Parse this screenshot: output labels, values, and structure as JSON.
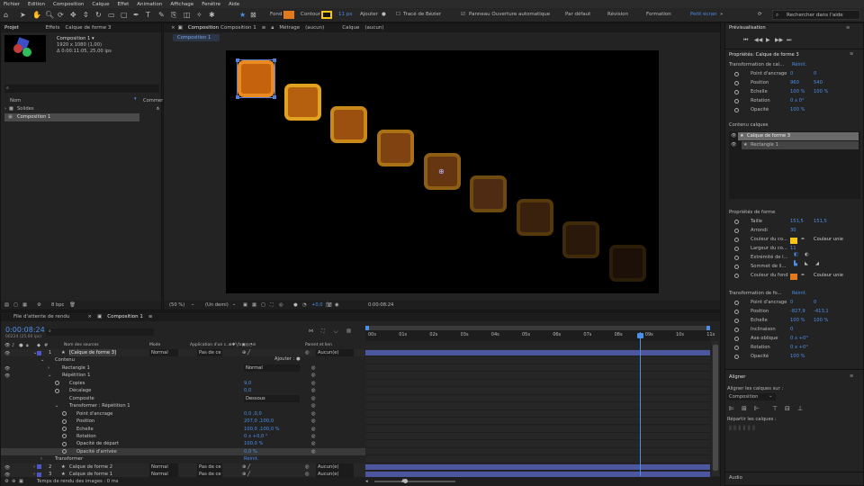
{
  "menu": [
    "Fichier",
    "Edition",
    "Composition",
    "Calque",
    "Effet",
    "Animation",
    "Affichage",
    "Fenêtre",
    "Aide"
  ],
  "toolbar": {
    "fond": "Fond",
    "contour": "Contour",
    "stroke_px": "11 px",
    "ajouter": "Ajouter",
    "bezier": "Tracé de Bézier",
    "panneau": "Panneau Ouverture automatique",
    "workspaces": [
      "Par défaut",
      "Révision",
      "Formation",
      "Petit écran"
    ],
    "search": "Rechercher dans l'aide",
    "fill_color": "#e07a1c",
    "stroke_color": "#f5c518"
  },
  "project": {
    "tab": "Projet",
    "effects_tab": "Effets",
    "effects_target": "Calque de forme 3",
    "info_name": "Composition 1 ▾",
    "info_size": "1920 x 1080 (1,00)",
    "info_dur": "Δ 0:00:11:05, 25,00 ips",
    "col_name": "Nom",
    "col_comment": "Commenta",
    "items": [
      "Solides",
      "Composition 1"
    ],
    "bpc": "8 bpc"
  },
  "viewer": {
    "tab": "Composition",
    "tab_comp": "Composition 1",
    "metrage": "Métrage",
    "metrage_val": "(aucun)",
    "calque": "Calque",
    "calque_val": "(aucun)",
    "breadcrumb": "Composition 1",
    "zoom": "(50 %)",
    "resolution": "(Un demi)",
    "exposure": "+0,0",
    "timecode": "0:00:08:24"
  },
  "preview": {
    "title": "Prévisualisation"
  },
  "properties": {
    "title": "Propriétés: Calque de forme 3",
    "transform_title": "Transformation de cal...",
    "reinit": "Réinit.",
    "transform": [
      {
        "label": "Point d'ancrage",
        "v1": "0",
        "v2": "0"
      },
      {
        "label": "Position",
        "v1": "960",
        "v2": "540"
      },
      {
        "label": "Echelle",
        "v1": "100 %",
        "v2": "100 %"
      },
      {
        "label": "Rotation",
        "v1": "0 x 0°",
        "v2": ""
      },
      {
        "label": "Opacité",
        "v1": "100 %",
        "v2": ""
      }
    ],
    "content_title": "Contenu calques",
    "content_items": [
      "Calque de forme 3",
      "Rectangle 1"
    ],
    "shape_title": "Propriétés de forme",
    "shape": [
      {
        "label": "Taille",
        "v1": "151,5",
        "v2": "151,5"
      },
      {
        "label": "Arrondi",
        "v1": "30",
        "v2": ""
      },
      {
        "label": "Couleur du co...",
        "v1": "Couleur unie",
        "v2": ""
      },
      {
        "label": "Largeur du co...",
        "v1": "11",
        "v2": ""
      },
      {
        "label": "Extrémité de l...",
        "v1": "",
        "v2": ""
      },
      {
        "label": "Sommet de li...",
        "v1": "",
        "v2": ""
      },
      {
        "label": "Couleur du fond",
        "v1": "Couleur unie",
        "v2": ""
      }
    ],
    "shape_transform_title": "Transformation de fo...",
    "shape_transform": [
      {
        "label": "Point d'ancrage",
        "v1": "0",
        "v2": "0"
      },
      {
        "label": "Position",
        "v1": "-827,9",
        "v2": "-413,1"
      },
      {
        "label": "Echelle",
        "v1": "100 %",
        "v2": "100 %"
      },
      {
        "label": "Inclinaison",
        "v1": "0",
        "v2": ""
      },
      {
        "label": "Axe oblique",
        "v1": "0 x +0°",
        "v2": ""
      },
      {
        "label": "Rotation",
        "v1": "0 x +0°",
        "v2": ""
      },
      {
        "label": "Opacité",
        "v1": "100 %",
        "v2": ""
      }
    ]
  },
  "align": {
    "title": "Aligner",
    "label": "Aligner les calques sur :",
    "target": "Composition",
    "distribute": "Répartir les calques :"
  },
  "audio": {
    "title": "Audio"
  },
  "timeline": {
    "tab_queue": "File d'attente de rendu",
    "tab_comp": "Composition 1",
    "timecode": "0:00:08:24",
    "frames": "00224 (25,00 ips)",
    "headers": {
      "name": "Nom des sources",
      "mode": "Mode",
      "app": "Application d'un c...",
      "parent": "Parent et lien"
    },
    "ajouter": "Ajouter :",
    "ruler": [
      "00s",
      "01s",
      "02s",
      "03s",
      "04s",
      "05s",
      "06s",
      "07s",
      "08s",
      "09s",
      "10s",
      "11s"
    ],
    "rows": [
      {
        "label": "[Calque de forme 3]",
        "indent": 0,
        "num": "1",
        "mode": "Normal",
        "match": "Pas de ce",
        "parent": "Aucun(e)",
        "value": ""
      },
      {
        "label": "Contenu",
        "indent": 1,
        "value": ""
      },
      {
        "label": "Rectangle 1",
        "indent": 2,
        "value": "Normal"
      },
      {
        "label": "Répétition 1",
        "indent": 2,
        "value": ""
      },
      {
        "label": "Copies",
        "indent": 3,
        "value": "9,0"
      },
      {
        "label": "Décalage",
        "indent": 3,
        "value": "0,0"
      },
      {
        "label": "Composite",
        "indent": 3,
        "value": "Dessous"
      },
      {
        "label": "Transformer : Répétition 1",
        "indent": 3,
        "value": ""
      },
      {
        "label": "Point d'ancrage",
        "indent": 4,
        "value": "0,0 ,0,0"
      },
      {
        "label": "Position",
        "indent": 4,
        "value": "207,0 ,100,0"
      },
      {
        "label": "Echelle",
        "indent": 4,
        "value": "100,0 ,100,0 %"
      },
      {
        "label": "Rotation",
        "indent": 4,
        "value": "0 x +0,0 °"
      },
      {
        "label": "Opacité de départ",
        "indent": 4,
        "value": "100,0 %"
      },
      {
        "label": "Opacité d'arrivée",
        "indent": 4,
        "value": "0,0 %"
      },
      {
        "label": "Transformer",
        "indent": 1,
        "value": "Réinit."
      },
      {
        "label": "Calque de forme 2",
        "indent": 0,
        "num": "2",
        "mode": "Normal",
        "match": "Pas de ce",
        "parent": "Aucun(e)",
        "value": ""
      },
      {
        "label": "Calque de forme 1",
        "indent": 0,
        "num": "3",
        "mode": "Normal",
        "match": "Pas de ce",
        "parent": "Aucun(e)",
        "value": ""
      }
    ],
    "render_time": "Temps de rendu des images : 0 ms"
  }
}
